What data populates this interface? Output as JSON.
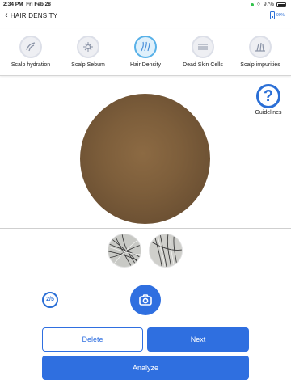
{
  "status_bar": {
    "time": "2:34 PM",
    "date": "Fri Feb 28",
    "battery": "97%"
  },
  "nav": {
    "back_icon": "chevron-left-icon",
    "title": "HAIR DENSITY",
    "device_battery": "90%"
  },
  "tabs": [
    {
      "label": "Scalp hydration",
      "icon": "hydration-icon",
      "active": false
    },
    {
      "label": "Scalp Sebum",
      "icon": "sebum-icon",
      "active": false
    },
    {
      "label": "Hair Density",
      "icon": "hair-density-icon",
      "active": true
    },
    {
      "label": "Dead Skin Cells",
      "icon": "dead-skin-icon",
      "active": false
    },
    {
      "label": "Scalp impurities",
      "icon": "impurities-icon",
      "active": false
    }
  ],
  "guidelines": {
    "symbol": "?",
    "label": "Guidelines"
  },
  "counter": "2/5",
  "buttons": {
    "delete": "Delete",
    "next": "Next",
    "analyze": "Analyze"
  },
  "colors": {
    "accent": "#2f6fe0",
    "active_tab_ring": "#58b1e8"
  }
}
